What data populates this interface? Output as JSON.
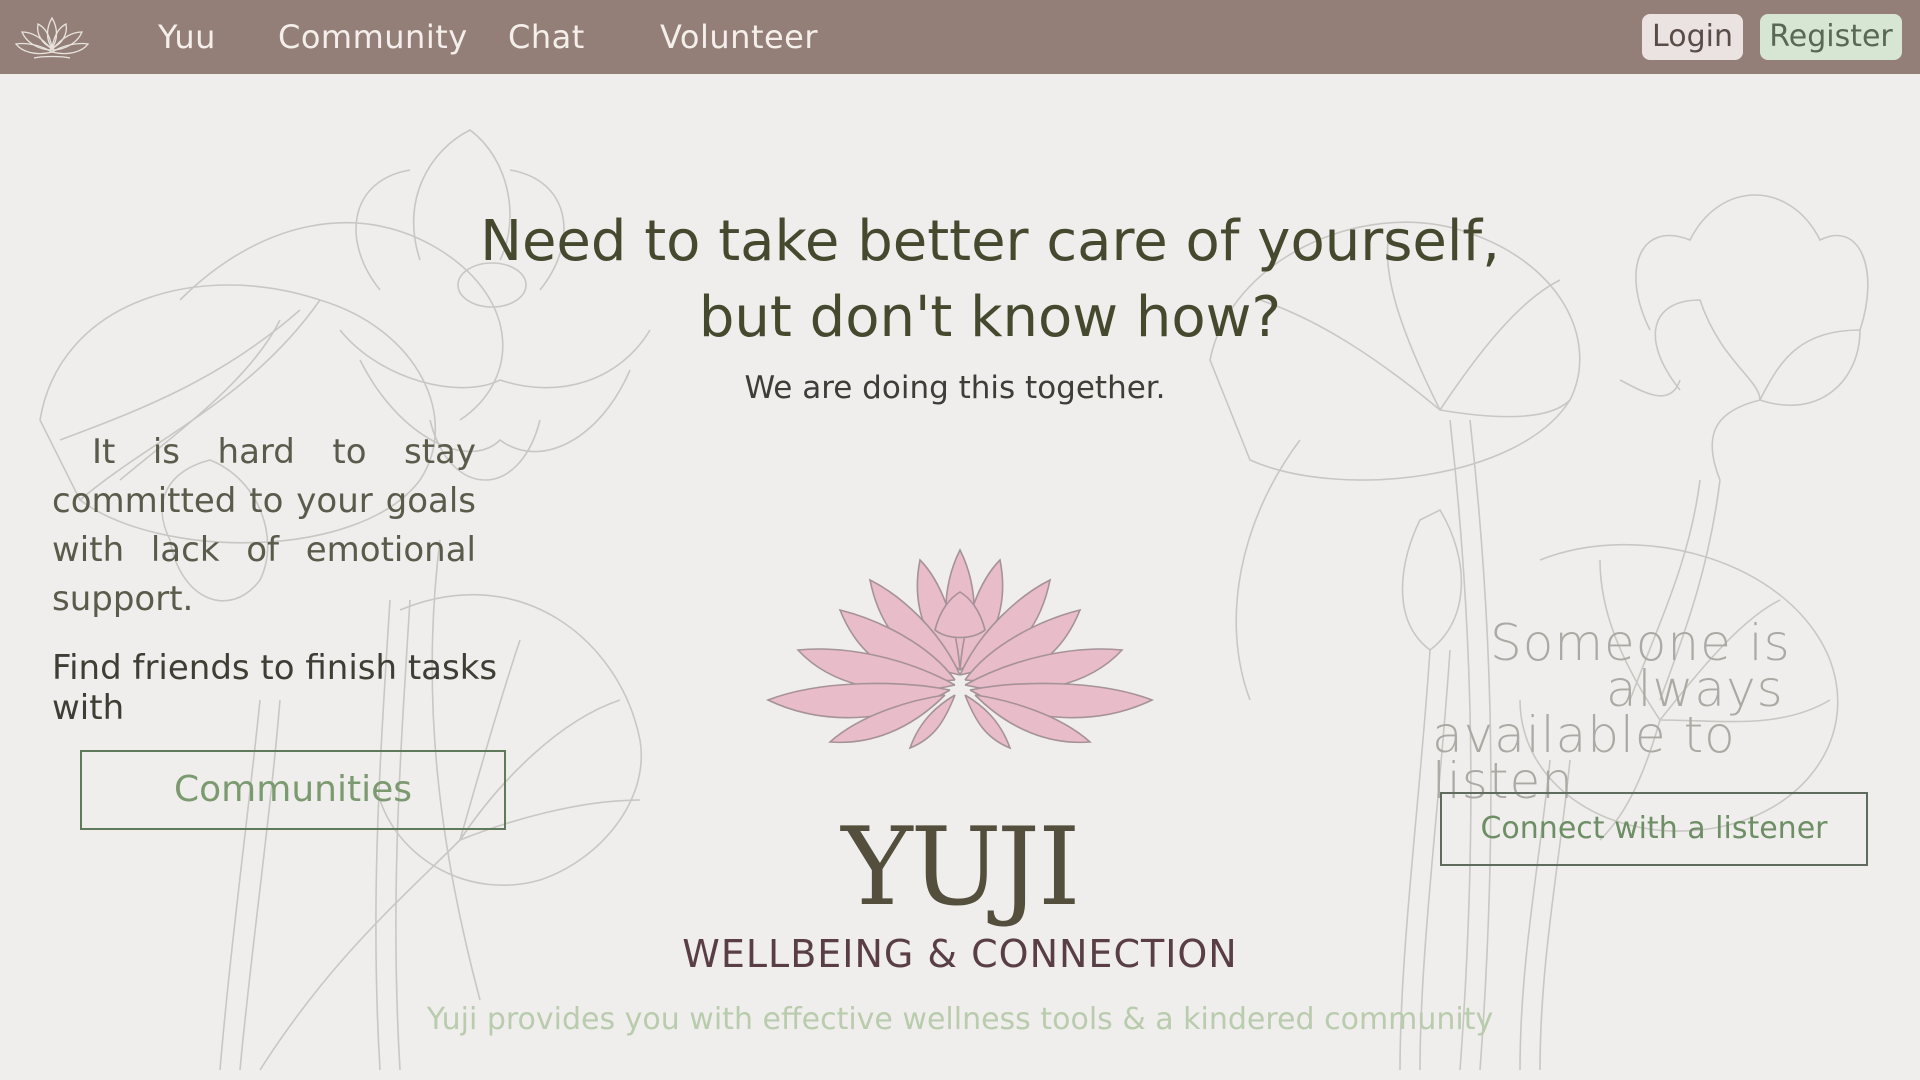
{
  "nav": {
    "links": [
      "Yuu",
      "Community",
      "Chat",
      "Volunteer"
    ],
    "login_label": "Login",
    "register_label": "Register"
  },
  "hero": {
    "title_line1": "Need to take better care of yourself,",
    "title_line2": "but don't know how?",
    "subtitle": "We are doing this together."
  },
  "left": {
    "paragraph": "It is hard to stay committed to your goals with lack of emotional support.",
    "find_text": "Find friends to finish tasks with",
    "communities_label": "Communities"
  },
  "right": {
    "listen_line1": "Someone is",
    "listen_line2": "always",
    "listen_line3": "available to listen",
    "listener_label": "Connect with a listener"
  },
  "brand": {
    "name": "YUJI",
    "tagline": "WELLBEING & CONNECTION",
    "description": "Yuji provides you with effective wellness tools & a kindered community"
  },
  "colors": {
    "header_bg": "#937f78",
    "page_bg": "#efeeec",
    "lotus_pink": "#e8bcc8",
    "accent_green": "#7b9a6f"
  },
  "icons": {
    "logo": "lotus-outline-icon",
    "hero_image": "pink-lotus-icon"
  }
}
